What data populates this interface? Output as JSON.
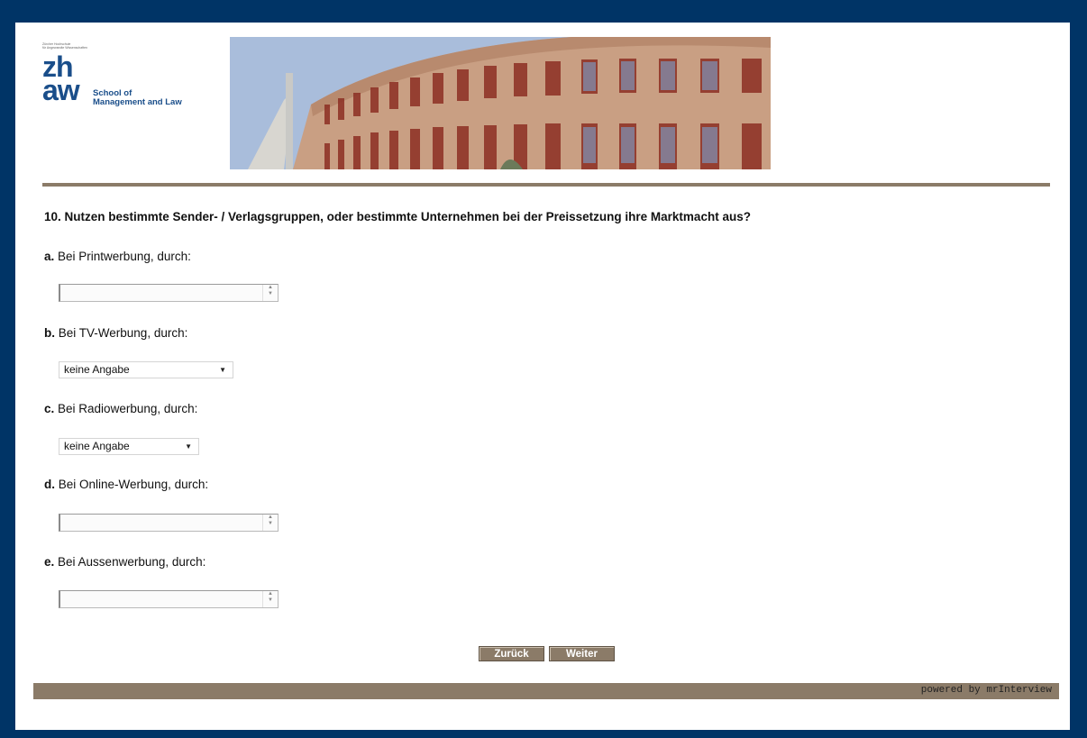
{
  "logo": {
    "small_text": "Zürcher Hochschule\nfür Angewandte Wissenschaften",
    "zh_text": "zh\naw",
    "school_text": "School of\nManagement and Law"
  },
  "question": {
    "title": "10. Nutzen bestimmte Sender- / Verlagsgruppen, oder bestimmte Unternehmen bei der Preissetzung ihre Marktmacht aus?"
  },
  "items": [
    {
      "letter": "a.",
      "label": "Bei Printwerbung, durch:",
      "control": "textarea",
      "value": ""
    },
    {
      "letter": "b.",
      "label": "Bei TV-Werbung, durch:",
      "control": "select",
      "value": "keine Angabe"
    },
    {
      "letter": "c.",
      "label": "Bei Radiowerbung, durch:",
      "control": "select",
      "value": "keine Angabe"
    },
    {
      "letter": "d.",
      "label": "Bei Online-Werbung, durch:",
      "control": "textarea",
      "value": ""
    },
    {
      "letter": "e.",
      "label": "Bei Aussenwerbung, durch:",
      "control": "textarea",
      "value": ""
    }
  ],
  "buttons": {
    "back_label": "Zurück",
    "next_label": "Weiter"
  },
  "footer": {
    "powered_by": "powered by mrInterview"
  },
  "colors": {
    "page_background": "#003466",
    "accent_brown": "#8b7b68",
    "logo_blue": "#1a4e8a"
  }
}
